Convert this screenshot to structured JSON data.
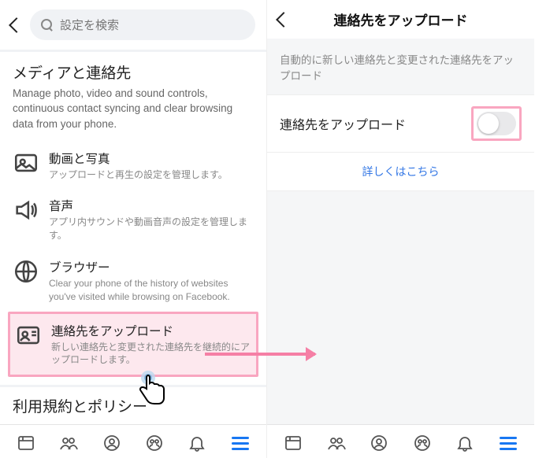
{
  "left": {
    "search_placeholder": "設定を検索",
    "section_title": "メディアと連絡先",
    "section_sub": "Manage photo, video and sound controls, continuous contact syncing and clear browsing data from your phone.",
    "rows": [
      {
        "title": "動画と写真",
        "sub": "アップロードと再生の設定を管理します。"
      },
      {
        "title": "音声",
        "sub": "アプリ内サウンドや動画音声の設定を管理します。"
      },
      {
        "title": "ブラウザー",
        "sub": "Clear your phone of the history of websites you've visited while browsing on Facebook."
      },
      {
        "title": "連絡先をアップロード",
        "sub": "新しい連絡先と変更された連絡先を継続的にアップロードします。"
      }
    ],
    "terms_title": "利用規約とポリシー"
  },
  "right": {
    "header_title": "連絡先をアップロード",
    "info": "自動的に新しい連絡先と変更された連絡先をアップロード",
    "toggle_label": "連絡先をアップロード",
    "learn_more": "詳しくはこちら"
  }
}
